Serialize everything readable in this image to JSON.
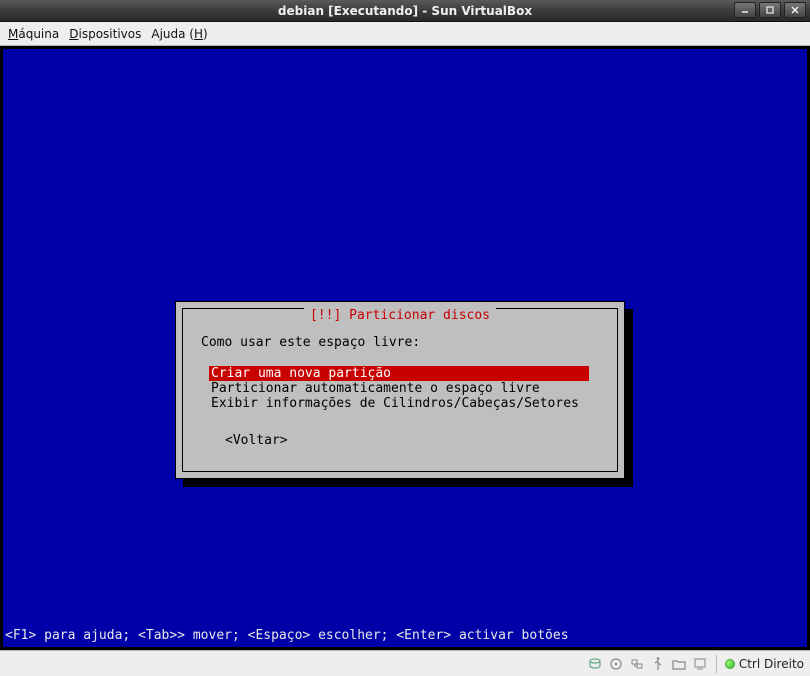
{
  "window": {
    "title": "debian [Executando] - Sun VirtualBox"
  },
  "menubar": {
    "items": [
      {
        "label": "Máquina",
        "underlineIndex": 0
      },
      {
        "label": "Dispositivos",
        "underlineIndex": 0
      },
      {
        "label": "Ajuda (H)",
        "underlineIndex": 7
      }
    ]
  },
  "installer": {
    "dialog": {
      "title_decor_left": "[!!] ",
      "title": "Particionar discos",
      "prompt": "Como usar este espaço livre:",
      "options": [
        {
          "label": "Criar uma nova partição",
          "selected": true
        },
        {
          "label": "Particionar automaticamente o espaço livre",
          "selected": false
        },
        {
          "label": "Exibir informações de Cilindros/Cabeças/Setores",
          "selected": false
        }
      ],
      "back_label": "<Voltar>"
    },
    "hint": "<F1> para ajuda; <Tab>> mover; <Espaço> escolher; <Enter> activar botões"
  },
  "statusbar": {
    "icons": [
      {
        "name": "hard-disk-icon"
      },
      {
        "name": "optical-disc-icon"
      },
      {
        "name": "network-icon"
      },
      {
        "name": "usb-icon"
      },
      {
        "name": "shared-folders-icon"
      },
      {
        "name": "vrdp-icon"
      }
    ],
    "hostkey_label": "Ctrl Direito"
  }
}
